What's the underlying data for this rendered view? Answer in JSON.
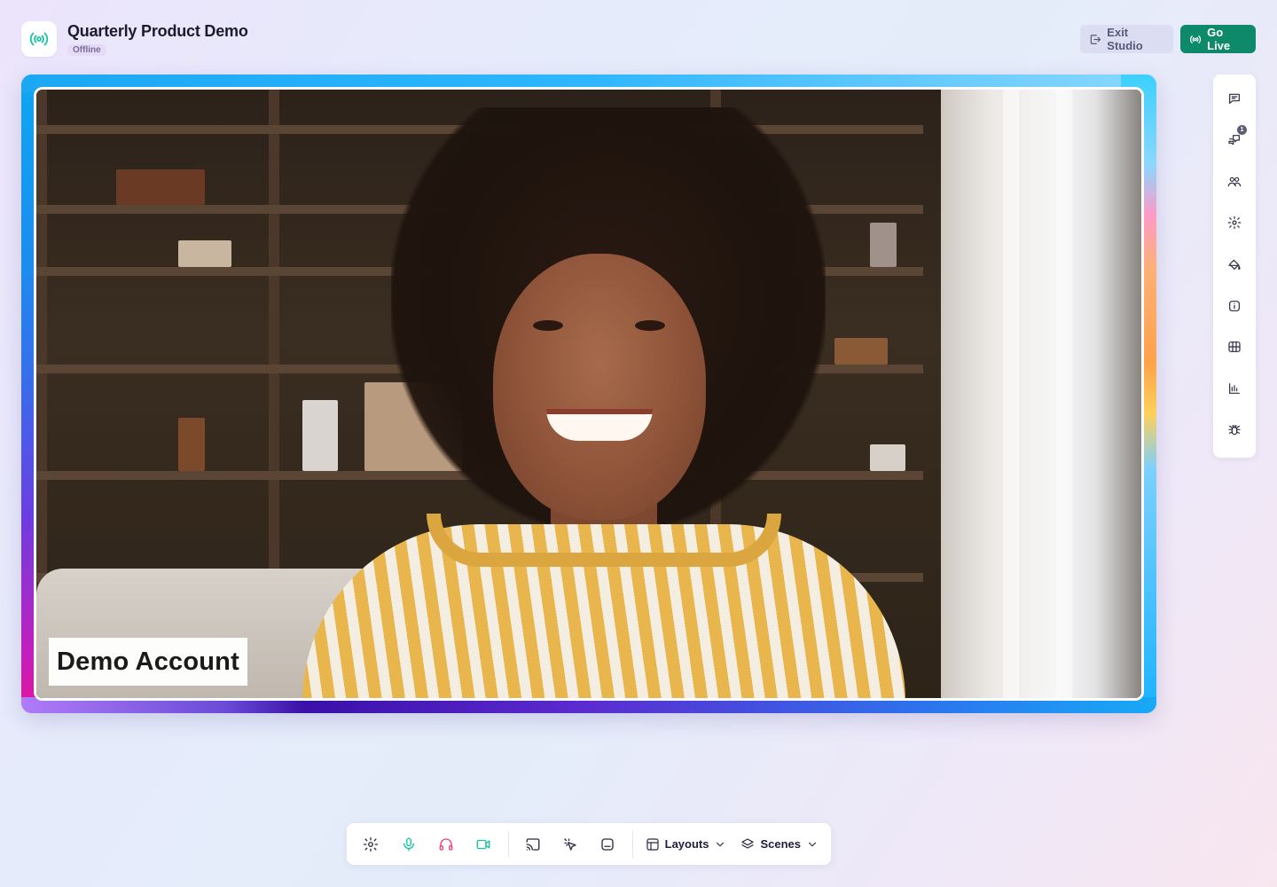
{
  "header": {
    "title": "Quarterly Product Demo",
    "status": "Offline",
    "exit_label": "Exit Studio",
    "golive_label": "Go Live"
  },
  "stage": {
    "participant_name": "Demo Account"
  },
  "rail": {
    "items": [
      {
        "icon": "chat-icon"
      },
      {
        "icon": "private-chat-icon",
        "badge": "1"
      },
      {
        "icon": "participants-icon"
      },
      {
        "icon": "settings-icon"
      },
      {
        "icon": "paint-bucket-icon"
      },
      {
        "icon": "info-icon"
      },
      {
        "icon": "media-library-icon"
      },
      {
        "icon": "analytics-icon"
      },
      {
        "icon": "bug-icon"
      }
    ]
  },
  "controls": {
    "layouts_label": "Layouts",
    "scenes_label": "Scenes"
  },
  "colors": {
    "accent_green": "#0e8a6b",
    "mic_teal": "#13c4a3",
    "headphones_pink": "#ec3d7a",
    "badge_purple": "#e5dbf5"
  }
}
